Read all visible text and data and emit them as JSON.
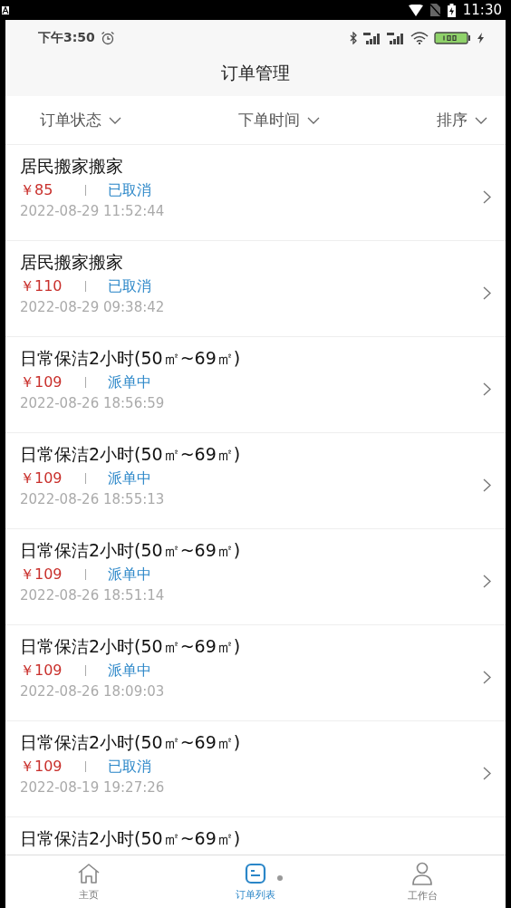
{
  "system_bar": {
    "time": "11:30"
  },
  "status_bar": {
    "time": "下午3:50"
  },
  "header": {
    "title": "订单管理"
  },
  "filters": [
    {
      "label": "订单状态"
    },
    {
      "label": "下单时间"
    },
    {
      "label": "排序"
    }
  ],
  "orders": [
    {
      "title": "居民搬家搬家",
      "price": "￥85",
      "status": "已取消",
      "time": "2022-08-29 11:52:44"
    },
    {
      "title": "居民搬家搬家",
      "price": "￥110",
      "status": "已取消",
      "time": "2022-08-29 09:38:42"
    },
    {
      "title": "日常保洁2小时(50㎡~69㎡)",
      "price": "￥109",
      "status": "派单中",
      "time": "2022-08-26 18:56:59"
    },
    {
      "title": "日常保洁2小时(50㎡~69㎡)",
      "price": "￥109",
      "status": "派单中",
      "time": "2022-08-26 18:55:13"
    },
    {
      "title": "日常保洁2小时(50㎡~69㎡)",
      "price": "￥109",
      "status": "派单中",
      "time": "2022-08-26 18:51:14"
    },
    {
      "title": "日常保洁2小时(50㎡~69㎡)",
      "price": "￥109",
      "status": "派单中",
      "time": "2022-08-26 18:09:03"
    },
    {
      "title": "日常保洁2小时(50㎡~69㎡)",
      "price": "￥109",
      "status": "已取消",
      "time": "2022-08-19 19:27:26"
    },
    {
      "title": "日常保洁2小时(50㎡~69㎡)"
    }
  ],
  "nav": [
    {
      "kind": "home",
      "label": "主页",
      "selected": false
    },
    {
      "kind": "list",
      "label": "订单列表",
      "selected": true
    },
    {
      "kind": "person",
      "label": "工作台",
      "selected": false
    }
  ]
}
